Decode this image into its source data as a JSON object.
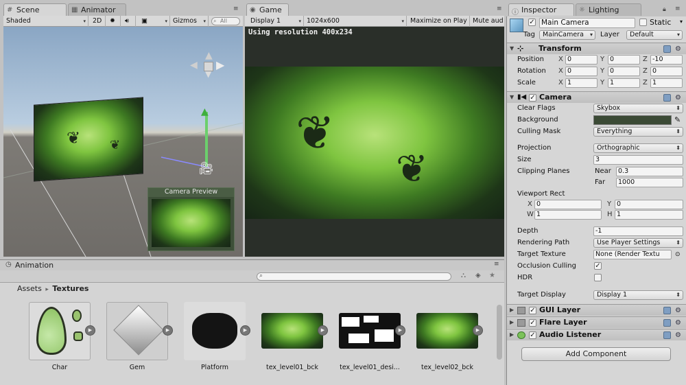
{
  "tabs": {
    "scene": "Scene",
    "animator": "Animator",
    "game": "Game",
    "inspector": "Inspector",
    "lighting": "Lighting",
    "animation": "Animation"
  },
  "scene_toolbar": {
    "shading": "Shaded",
    "mode_2d": "2D",
    "gizmos": "Gizmos",
    "search_placeholder": "All",
    "camera_preview_title": "Camera Preview"
  },
  "game_toolbar": {
    "display": "Display 1",
    "resolution": "1024x600",
    "maximize": "Maximize on Play",
    "mute": "Mute aud",
    "resolution_note": "Using resolution 400x234"
  },
  "inspector": {
    "object_name": "Main Camera",
    "static_label": "Static",
    "tag_label": "Tag",
    "tag_value": "MainCamera",
    "layer_label": "Layer",
    "layer_value": "Default",
    "transform": {
      "title": "Transform",
      "position_label": "Position",
      "rotation_label": "Rotation",
      "scale_label": "Scale",
      "position": [
        "0",
        "0",
        "-10"
      ],
      "rotation": [
        "0",
        "0",
        "0"
      ],
      "scale": [
        "1",
        "1",
        "1"
      ],
      "axes": [
        "X",
        "Y",
        "Z"
      ]
    },
    "camera": {
      "title": "Camera",
      "clear_flags_label": "Clear Flags",
      "clear_flags": "Skybox",
      "background_label": "Background",
      "culling_mask_label": "Culling Mask",
      "culling_mask": "Everything",
      "projection_label": "Projection",
      "projection": "Orthographic",
      "size_label": "Size",
      "size": "3",
      "clipping_label": "Clipping Planes",
      "near_label": "Near",
      "near": "0.3",
      "far_label": "Far",
      "far": "1000",
      "viewport_label": "Viewport Rect",
      "vp_x_label": "X",
      "vp_x": "0",
      "vp_y_label": "Y",
      "vp_y": "0",
      "vp_w_label": "W",
      "vp_w": "1",
      "vp_h_label": "H",
      "vp_h": "1",
      "depth_label": "Depth",
      "depth": "-1",
      "rendering_path_label": "Rendering Path",
      "rendering_path": "Use Player Settings",
      "target_texture_label": "Target Texture",
      "target_texture": "None (Render Textu",
      "occlusion_label": "Occlusion Culling",
      "hdr_label": "HDR",
      "target_display_label": "Target Display",
      "target_display": "Display 1"
    },
    "components": [
      "GUI Layer",
      "Flare Layer",
      "Audio Listener"
    ],
    "add_component": "Add Component"
  },
  "project": {
    "breadcrumb_root": "Assets",
    "breadcrumb_sep": "▸",
    "breadcrumb_current": "Textures",
    "assets": [
      "Char",
      "Gem",
      "Platform",
      "tex_level01_bck",
      "tex_level01_desi...",
      "tex_level02_bck"
    ]
  },
  "colors": {
    "panel": "#c2c2c2",
    "inspector_bg": "#d6d6d6",
    "camera_background": "#3b4a35",
    "game_bg": "#2a2f29"
  }
}
